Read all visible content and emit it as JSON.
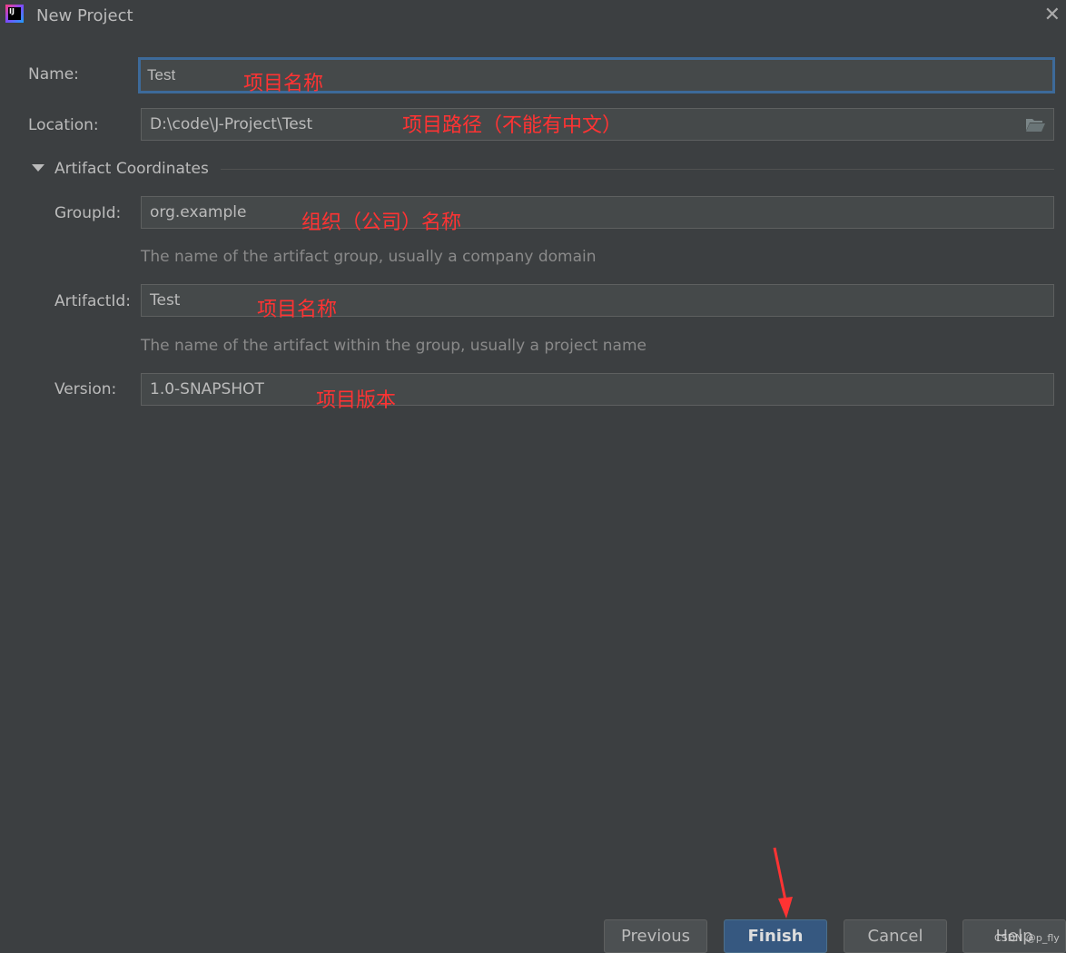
{
  "window": {
    "title": "New Project",
    "logo_text": "IJ"
  },
  "form": {
    "name": {
      "label": "Name:",
      "value": "Test",
      "annotation": "项目名称"
    },
    "location": {
      "label": "Location:",
      "value": "D:\\code\\J-Project\\Test",
      "annotation": "项目路径（不能有中文）"
    },
    "section": {
      "label": "Artifact Coordinates",
      "expanded": true
    },
    "group_id": {
      "label": "GroupId:",
      "value": "org.example",
      "hint": "The name of the artifact group, usually a company domain",
      "annotation": "组织（公司）名称"
    },
    "artifact_id": {
      "label": "ArtifactId:",
      "value": "Test",
      "hint": "The name of the artifact within the group, usually a project name",
      "annotation": "项目名称"
    },
    "version": {
      "label": "Version:",
      "value": "1.0-SNAPSHOT",
      "annotation": "项目版本"
    }
  },
  "buttons": {
    "previous": "Previous",
    "finish": "Finish",
    "cancel": "Cancel",
    "help": "Help"
  },
  "watermark": "CSDN @p_fly",
  "colors": {
    "accent": "#365880",
    "focus_border": "#3d6a9a",
    "annotation": "#ff3333",
    "background": "#3c3f41"
  }
}
